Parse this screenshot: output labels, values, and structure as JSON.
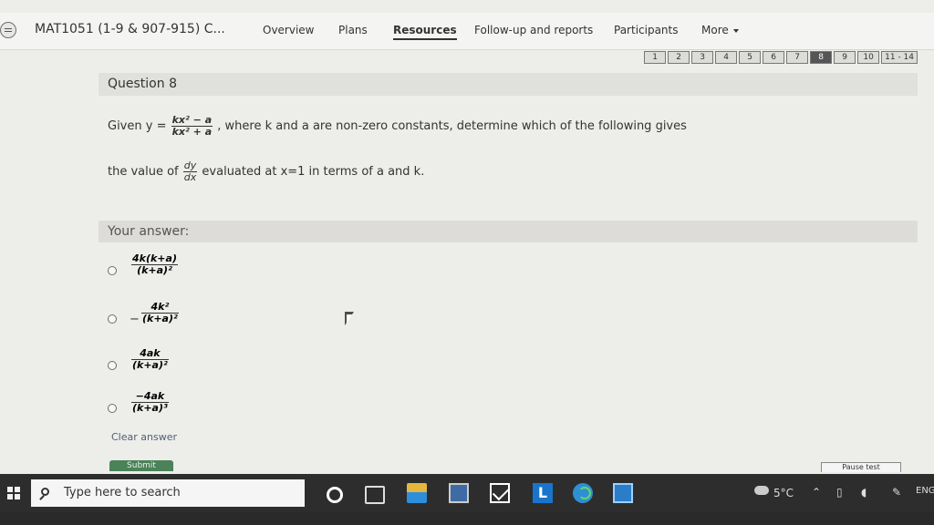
{
  "app": {
    "course_title": "MAT1051 (1-9 & 907-915) C...",
    "nav_items": [
      {
        "label": "Overview",
        "active": false
      },
      {
        "label": "Plans",
        "active": false
      },
      {
        "label": "Resources",
        "active": true
      },
      {
        "label": "Follow-up and reports",
        "active": false
      },
      {
        "label": "Participants",
        "active": false
      },
      {
        "label": "More",
        "active": false
      }
    ],
    "pages": [
      "1",
      "2",
      "3",
      "4",
      "5",
      "6",
      "7",
      "8",
      "9",
      "10",
      "11 - 14"
    ],
    "active_page": "8"
  },
  "question": {
    "title": "Question 8",
    "given_prefix": "Given y =",
    "given_num": "kx² − a",
    "given_den": "kx² + a",
    "given_suffix": ", where k and a are non-zero constants, determine which of the following gives",
    "line2_prefix": "the value of",
    "line2_num": "dy",
    "line2_den": "dx",
    "line2_suffix": "evaluated at x=1 in terms of a and k."
  },
  "answer": {
    "title": "Your answer:",
    "options": [
      {
        "sign": "",
        "numerator": "4k(k+a)",
        "denominator": "(k+a)²"
      },
      {
        "sign": "−",
        "numerator": "4k²",
        "denominator": "(k+a)²"
      },
      {
        "sign": "",
        "numerator": "4ak",
        "denominator": "(k+a)²"
      },
      {
        "sign": "",
        "numerator": "−4ak",
        "denominator": "(k+a)³"
      }
    ],
    "clear_label": "Clear answer",
    "submit_label": "Submit",
    "pause_label": "Pause test"
  },
  "taskbar": {
    "search_placeholder": "Type here to search",
    "temperature": "5°C",
    "language": "ENG",
    "icons": [
      "windows-start-icon",
      "cortana-icon",
      "task-view-icon",
      "file-explorer-icon",
      "store-icon",
      "mail-icon",
      "l-app-icon",
      "edge-icon",
      "app-icon"
    ]
  }
}
